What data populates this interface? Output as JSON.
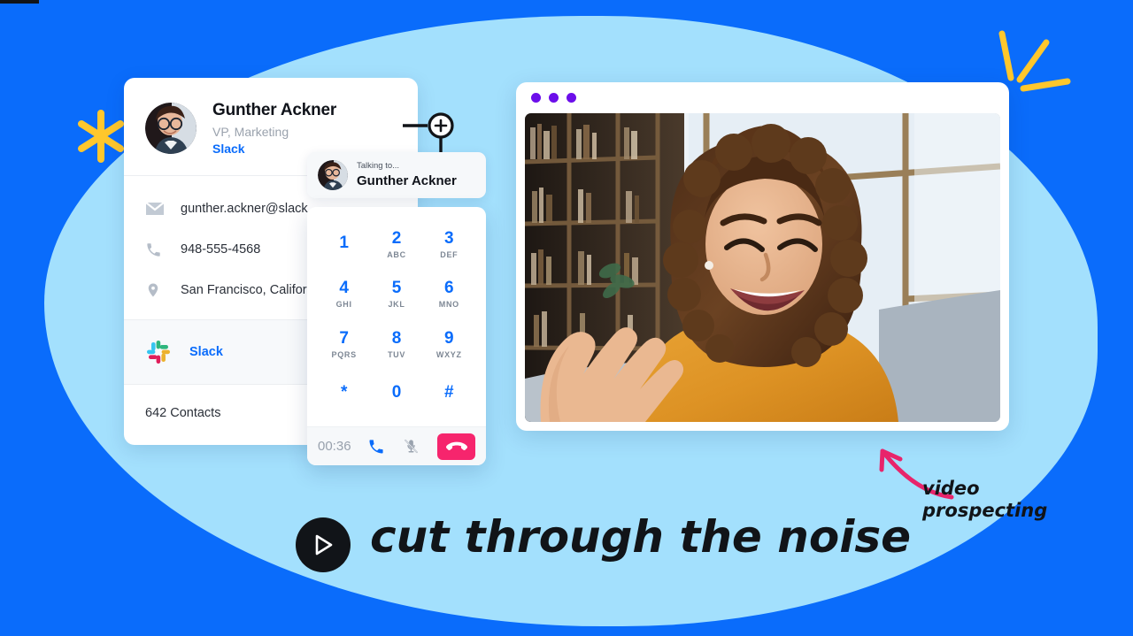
{
  "theme": {
    "background_blue": "#0a6cfb",
    "blob_light_blue": "#a3e0fd",
    "accent_blue": "#0a6cfb",
    "accent_pink": "#f6256d",
    "accent_yellow": "#ffc72c",
    "window_dot_purple": "#6c0eea",
    "ink": "#111418"
  },
  "decorations": {
    "star_icon": "asterisk-star",
    "rays_icon": "three-rays",
    "arrow_icon": "curved-arrow"
  },
  "contact_card": {
    "name": "Gunther Ackner",
    "role": "VP, Marketing",
    "org": "Slack",
    "avatar_alt": "Gunther Ackner portrait",
    "rows": [
      {
        "icon": "envelope-icon",
        "value": "gunther.ackner@slack."
      },
      {
        "icon": "phone-icon",
        "value": "948-555-4568"
      },
      {
        "icon": "map-pin-icon",
        "value": "San Francisco, Californ"
      }
    ],
    "integration": {
      "icon": "slack-logo-icon",
      "label": "Slack"
    },
    "footer": "642 Contacts"
  },
  "talking_pill": {
    "eyebrow": "Talking to...",
    "name": "Gunther Ackner",
    "avatar_alt": "Gunther Ackner portrait"
  },
  "dialpad": {
    "keys": [
      {
        "digit": "1",
        "letters": ""
      },
      {
        "digit": "2",
        "letters": "ABC"
      },
      {
        "digit": "3",
        "letters": "DEF"
      },
      {
        "digit": "4",
        "letters": "GHI"
      },
      {
        "digit": "5",
        "letters": "JKL"
      },
      {
        "digit": "6",
        "letters": "MNO"
      },
      {
        "digit": "7",
        "letters": "PQRS"
      },
      {
        "digit": "8",
        "letters": "TUV"
      },
      {
        "digit": "9",
        "letters": "WXYZ"
      },
      {
        "digit": "*",
        "letters": ""
      },
      {
        "digit": "0",
        "letters": ""
      },
      {
        "digit": "#",
        "letters": ""
      }
    ],
    "call_bar": {
      "timer": "00:36",
      "call_icon": "phone-icon",
      "mute_icon": "microphone-muted-icon",
      "hangup_icon": "phone-hangup-icon"
    }
  },
  "video_window": {
    "dots": [
      "dot",
      "dot",
      "dot"
    ],
    "screen_alt": "Smiling woman waving on a video call, bookshelf and window behind her"
  },
  "caption": {
    "play_icon": "play-icon",
    "text": "cut through the noise"
  },
  "annotation": {
    "line1": "video",
    "line2": "prospecting"
  },
  "connector": {
    "plus_icon": "plus-icon"
  }
}
